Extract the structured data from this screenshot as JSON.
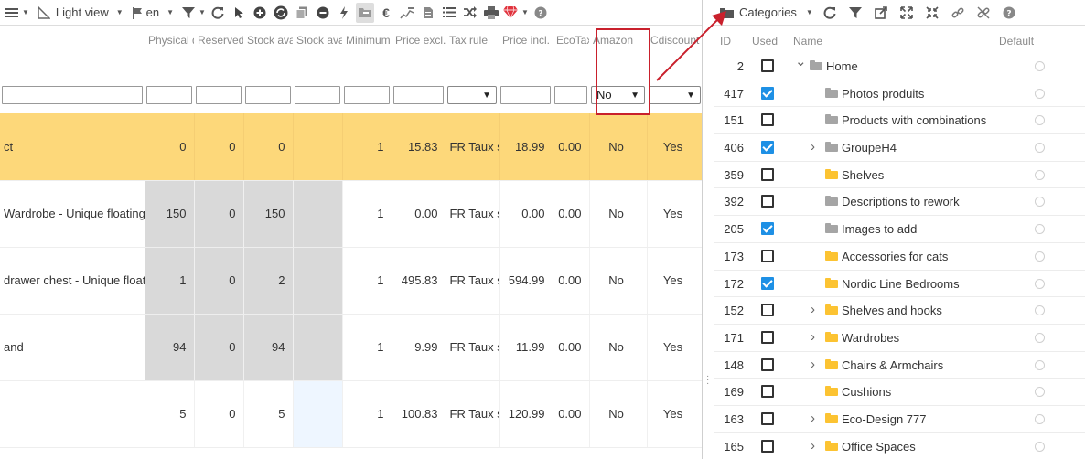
{
  "toolbar": {
    "view_label": "Light view",
    "lang_label": "en"
  },
  "grid": {
    "headers": [
      "Physical quantity",
      "Reserved quantity",
      "Stock available",
      "Stock available +/-",
      "Minimum quantity",
      "Price excl. Tax",
      "Tax rule",
      "Price incl. Tax",
      "EcoTax",
      "Amazon",
      "Cdiscount"
    ],
    "amazon_filter": "No",
    "rows": [
      {
        "name": "ct",
        "physical": "0",
        "reserved": "0",
        "available": "0",
        "minimum": "1",
        "price_excl": "15.83",
        "tax_rule": "FR Taux s",
        "price_incl": "18.99",
        "ecotax": "0.00",
        "amazon": "No",
        "cdiscount": "Yes"
      },
      {
        "name": "Wardrobe - Unique floating de",
        "physical": "150",
        "reserved": "0",
        "available": "150",
        "minimum": "1",
        "price_excl": "0.00",
        "tax_rule": "FR Taux s",
        "price_incl": "0.00",
        "ecotax": "0.00",
        "amazon": "No",
        "cdiscount": "Yes"
      },
      {
        "name": " drawer chest - Unique floati",
        "physical": "1",
        "reserved": "0",
        "available": "2",
        "minimum": "1",
        "price_excl": "495.83",
        "tax_rule": "FR Taux s",
        "price_incl": "594.99",
        "ecotax": "0.00",
        "amazon": "No",
        "cdiscount": "Yes"
      },
      {
        "name": "and",
        "physical": "94",
        "reserved": "0",
        "available": "94",
        "minimum": "1",
        "price_excl": "9.99",
        "tax_rule": "FR Taux s",
        "price_incl": "11.99",
        "ecotax": "0.00",
        "amazon": "No",
        "cdiscount": "Yes"
      },
      {
        "name": "",
        "physical": "5",
        "reserved": "0",
        "available": "5",
        "minimum": "1",
        "price_excl": "100.83",
        "tax_rule": "FR Taux s",
        "price_incl": "120.99",
        "ecotax": "0.00",
        "amazon": "No",
        "cdiscount": "Yes"
      }
    ]
  },
  "categories": {
    "dropdown_label": "Categories",
    "columns": {
      "id": "ID",
      "used": "Used",
      "name": "Name",
      "default": "Default"
    },
    "rows": [
      {
        "id": "2",
        "used": false,
        "name": "Home",
        "expander": "down",
        "folder": "gray",
        "depth": 0
      },
      {
        "id": "417",
        "used": true,
        "name": "Photos produits",
        "expander": "",
        "folder": "gray",
        "depth": 1
      },
      {
        "id": "151",
        "used": false,
        "name": "Products with combinations",
        "expander": "",
        "folder": "gray",
        "depth": 1
      },
      {
        "id": "406",
        "used": true,
        "name": "GroupeH4",
        "expander": "right",
        "folder": "gray",
        "depth": 1
      },
      {
        "id": "359",
        "used": false,
        "name": "Shelves",
        "expander": "",
        "folder": "yellow",
        "depth": 1
      },
      {
        "id": "392",
        "used": false,
        "name": "Descriptions to rework",
        "expander": "",
        "folder": "gray",
        "depth": 1
      },
      {
        "id": "205",
        "used": true,
        "name": "Images to add",
        "expander": "",
        "folder": "gray",
        "depth": 1
      },
      {
        "id": "173",
        "used": false,
        "name": "Accessories for cats",
        "expander": "",
        "folder": "yellow",
        "depth": 1
      },
      {
        "id": "172",
        "used": true,
        "name": "Nordic Line Bedrooms",
        "expander": "",
        "folder": "yellow",
        "depth": 1
      },
      {
        "id": "152",
        "used": false,
        "name": "Shelves and hooks",
        "expander": "right",
        "folder": "yellow",
        "depth": 1
      },
      {
        "id": "171",
        "used": false,
        "name": "Wardrobes",
        "expander": "right",
        "folder": "yellow",
        "depth": 1
      },
      {
        "id": "148",
        "used": false,
        "name": "Chairs & Armchairs",
        "expander": "right",
        "folder": "yellow",
        "depth": 1
      },
      {
        "id": "169",
        "used": false,
        "name": "Cushions",
        "expander": "",
        "folder": "yellow",
        "depth": 1
      },
      {
        "id": "163",
        "used": false,
        "name": "Eco-Design 777",
        "expander": "right",
        "folder": "yellow",
        "depth": 1
      },
      {
        "id": "165",
        "used": false,
        "name": "Office Spaces",
        "expander": "right",
        "folder": "yellow",
        "depth": 1
      }
    ]
  },
  "colors": {
    "highlight_row": "#fdd87a",
    "checkbox_checked": "#1e90e5",
    "callout": "#c9202c",
    "folder_yellow": "#fcc332",
    "folder_gray": "#a5a5a5"
  }
}
